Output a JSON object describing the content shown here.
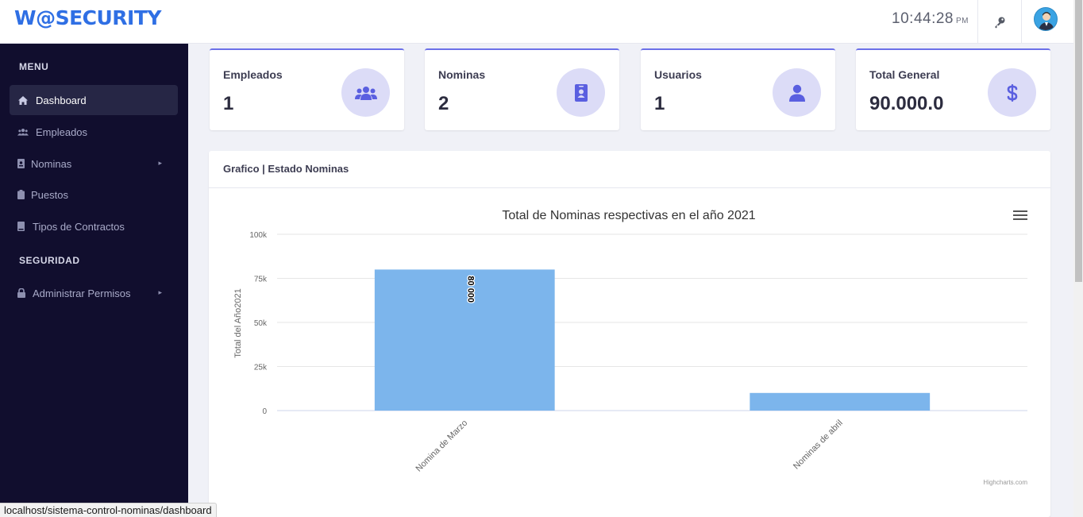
{
  "brand": "W@SECURITY",
  "clock": {
    "time": "10:44:28",
    "ampm": "PM"
  },
  "colors": {
    "brand": "#2f6fe4",
    "sidebar_bg": "#110e2e",
    "accent": "#6c70e8",
    "bar": "#7cb5ec"
  },
  "sidebar": {
    "menu_header": "MENU",
    "items": [
      {
        "label": "Dashboard",
        "icon": "home-icon",
        "active": true
      },
      {
        "label": "Empleados",
        "icon": "users-icon"
      },
      {
        "label": "Nominas",
        "icon": "id-badge-icon",
        "has_submenu": true
      },
      {
        "label": "Puestos",
        "icon": "clipboard-icon"
      },
      {
        "label": "Tipos de Contractos",
        "icon": "book-icon"
      }
    ],
    "security_header": "SEGURIDAD",
    "security_items": [
      {
        "label": "Administrar Permisos",
        "icon": "lock-icon",
        "has_submenu": true
      }
    ]
  },
  "cards": [
    {
      "label": "Empleados",
      "value": "1",
      "icon": "users-icon"
    },
    {
      "label": "Nominas",
      "value": "2",
      "icon": "id-badge-icon"
    },
    {
      "label": "Usuarios",
      "value": "1",
      "icon": "user-icon"
    },
    {
      "label": "Total General",
      "value": "90.000.0",
      "icon": "dollar-icon"
    }
  ],
  "panel": {
    "title": "Grafico | Estado Nominas"
  },
  "chart_data": {
    "type": "bar",
    "title": "Total de Nominas respectivas en el año 2021",
    "ylabel": "Total del Año2021",
    "categories": [
      "Nomina de Marzo",
      "Nominas de abril"
    ],
    "values": [
      80000,
      10000
    ],
    "data_labels": [
      "80 000",
      ""
    ],
    "ylim": [
      0,
      100000
    ],
    "yticks": [
      0,
      25000,
      50000,
      75000,
      100000
    ],
    "ytick_labels": [
      "0",
      "25k",
      "50k",
      "75k",
      "100k"
    ],
    "grid": true,
    "credits": "Highcharts.com"
  },
  "statusbar": "localhost/sistema-control-nominas/dashboard"
}
